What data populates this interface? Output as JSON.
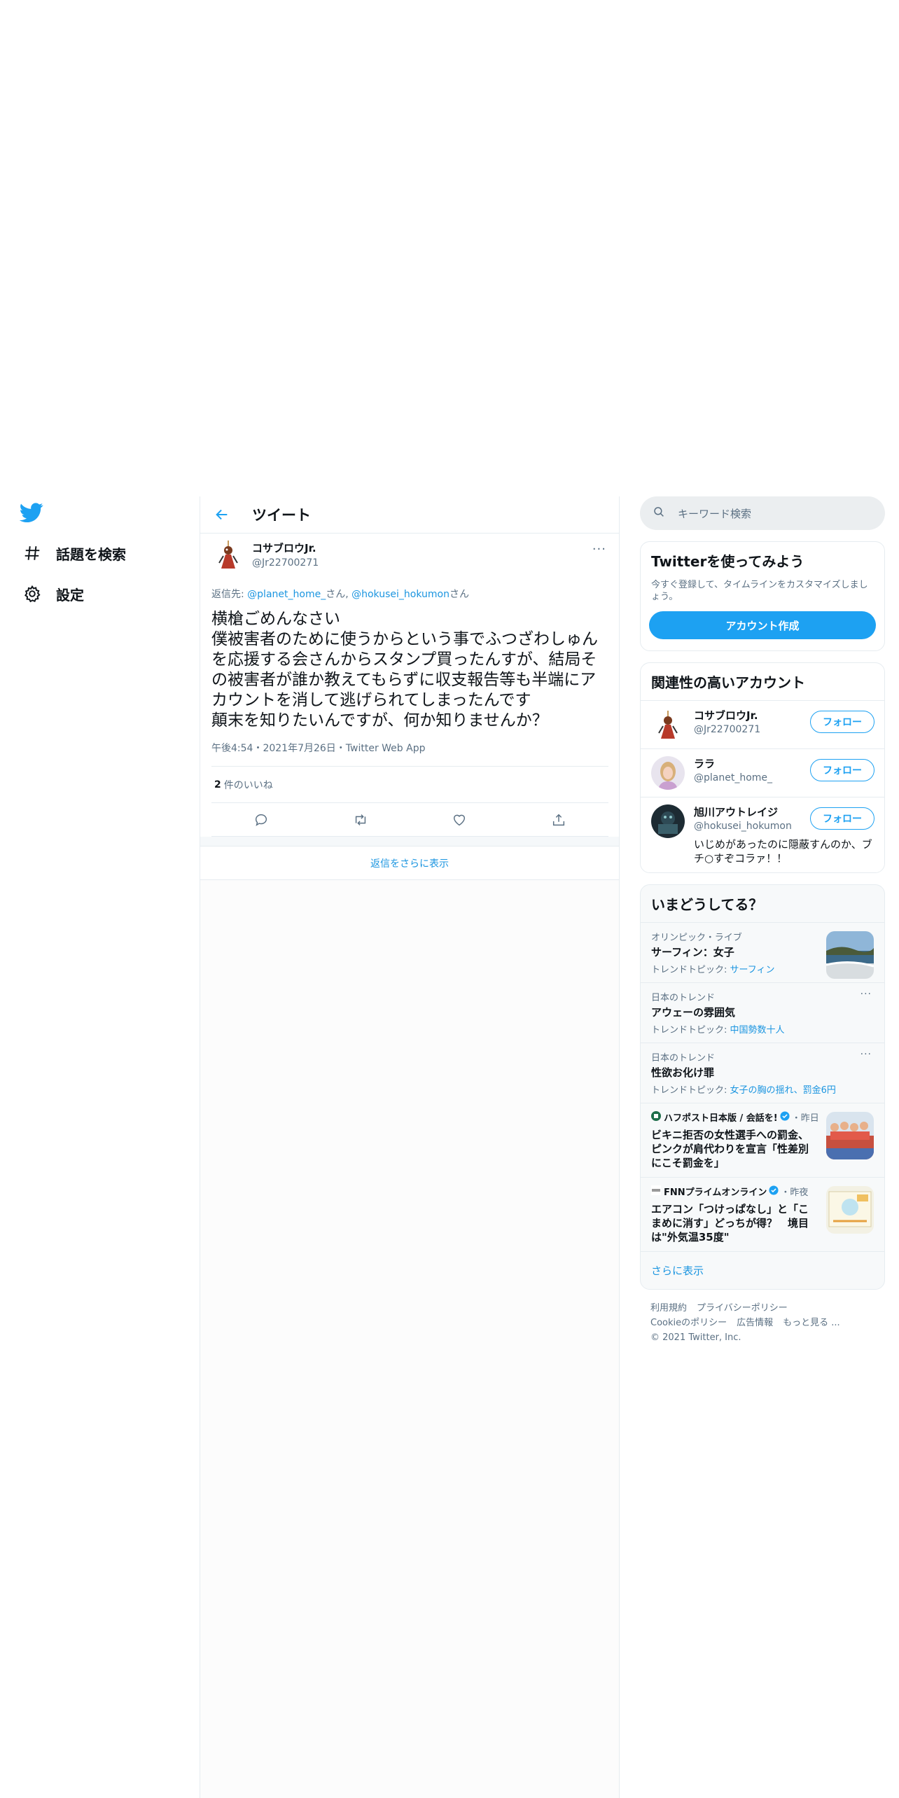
{
  "nav": {
    "explore_label": "話題を検索",
    "settings_label": "設定"
  },
  "header": {
    "title": "ツイート"
  },
  "tweet": {
    "author_name": "コサブロウJr.",
    "author_handle": "@Jr22700271",
    "more_label": "···",
    "reply_prefix": "返信先: ",
    "reply_user1": "@planet_home_",
    "reply_san1": "さん, ",
    "reply_user2": "@hokusei_hokumon",
    "reply_san2": "さん",
    "text": "横槍ごめんなさい\n僕被害者のために使うからという事でふつざわしゅんを応援する会さんからスタンプ買ったんすが、結局その被害者が誰か教えてもらずに収支報告等も半端にアカウントを消して逃げられてしまったんです\n顛末を知りたいんですが、何か知りませんか？",
    "meta": "午後4:54・2021年7月26日・Twitter Web App",
    "likes_count": "2",
    "likes_label": "件のいいね"
  },
  "show_more_replies": "返信をさらに表示",
  "search": {
    "placeholder": "キーワード検索"
  },
  "signup": {
    "title": "Twitterを使ってみよう",
    "desc": "今すぐ登録して、タイムラインをカスタマイズしましょう。",
    "button": "アカウント作成"
  },
  "related": {
    "title": "関連性の高いアカウント",
    "follow_label": "フォロー",
    "accounts": [
      {
        "name": "コサブロウJr.",
        "handle": "@Jr22700271",
        "bio": ""
      },
      {
        "name": "ララ",
        "handle": "@planet_home_",
        "bio": ""
      },
      {
        "name": "旭川アウトレイジ",
        "handle": "@hokusei_hokumon",
        "bio": "いじめがあったのに隠蔽すんのか、ブチ○すぞコラァ！！"
      }
    ]
  },
  "trends": {
    "title": "いまどうしてる？",
    "items": [
      {
        "category": "オリンピック・ライブ",
        "title": "サーフィン：女子",
        "topic_label": "トレンドトピック: ",
        "topic": "サーフィン"
      },
      {
        "category": "日本のトレンド",
        "title": "アウェーの雰囲気",
        "topic_label": "トレンドトピック: ",
        "topic": "中国勢数十人"
      },
      {
        "category": "日本のトレンド",
        "title": "性欲お化け罪",
        "topic_label": "トレンドトピック: ",
        "topic": "女子の胸の揺れ、罰金6円"
      }
    ],
    "news": [
      {
        "source": "ハフポスト日本版 / 会話を!",
        "time": "・昨日",
        "title": "ビキニ拒否の女性選手への罰金、ピンクが肩代わりを宣言「性差別にこそ罰金を」"
      },
      {
        "source": "FNNプライムオンライン",
        "time": "・昨夜",
        "title": "エアコン「つけっぱなし」と「こまめに消す」どっちが得？　境目は\"外気温35度\""
      }
    ],
    "more_label": "さらに表示",
    "more_dots": "···"
  },
  "footer": {
    "links_row1": [
      "利用規約",
      "プライバシーポリシー"
    ],
    "links_row2": [
      "Cookieのポリシー",
      "広告情報",
      "もっと見る ..."
    ],
    "copyright": "© 2021 Twitter, Inc."
  },
  "colors": {
    "accent": "#1da1f2",
    "link": "#1b95e0",
    "muted": "#5b7083",
    "border": "#e6ecf0"
  }
}
